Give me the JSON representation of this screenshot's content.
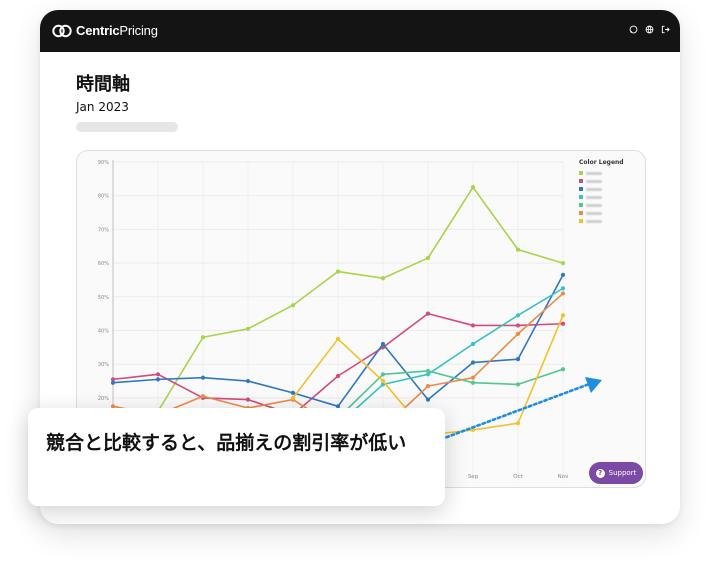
{
  "app": {
    "logo_text_bold": "Centric",
    "logo_text_light": "Pricing",
    "top_icons": [
      "chat-icon",
      "globe-icon",
      "logout-icon"
    ]
  },
  "page": {
    "title": "時間軸",
    "date": "Jan 2023"
  },
  "chart_data": {
    "type": "line",
    "y_ticks": [
      "90%",
      "80%",
      "70%",
      "60%",
      "50%",
      "40%",
      "30%",
      "20%"
    ],
    "x_ticks_visible": [
      "Sep",
      "Oct",
      "Nov"
    ],
    "ylim": [
      0,
      90
    ],
    "grid": true,
    "legend_title": "Color Legend",
    "legend_placement": "top-right",
    "series": [
      {
        "color": "#a8d44a",
        "values": [
          null,
          16,
          38,
          40.5,
          47.5,
          57.5,
          55.5,
          61.5,
          82.5,
          64,
          60
        ]
      },
      {
        "color": "#d64a7a",
        "values": [
          25.5,
          27,
          20,
          19.5,
          15,
          26.5,
          35,
          45,
          41.5,
          41.5,
          42
        ]
      },
      {
        "color": "#2f77c4",
        "values": [
          24.5,
          25.5,
          26,
          25,
          21.5,
          17.5,
          36,
          19.5,
          30.5,
          31.5,
          56.5
        ]
      },
      {
        "color": "#36c3c5",
        "values": [
          null,
          null,
          null,
          null,
          null,
          12,
          24,
          27,
          36,
          44.5,
          52.5
        ]
      },
      {
        "color": "#4ec98f",
        "values": [
          null,
          null,
          null,
          null,
          null,
          14,
          27,
          28,
          24.5,
          24,
          28.5
        ]
      },
      {
        "color": "#ee8a4a",
        "values": [
          17.5,
          15,
          20.5,
          17,
          19.5,
          11,
          11,
          23.5,
          26,
          39,
          51
        ]
      },
      {
        "color": "#f3c22a",
        "values": [
          null,
          null,
          null,
          null,
          20,
          37.5,
          25,
          9,
          10.5,
          12.5,
          44.5
        ]
      }
    ]
  },
  "support": {
    "label": "Support"
  },
  "callout": {
    "text": "競合と比較すると、品揃えの割引率が低い"
  }
}
